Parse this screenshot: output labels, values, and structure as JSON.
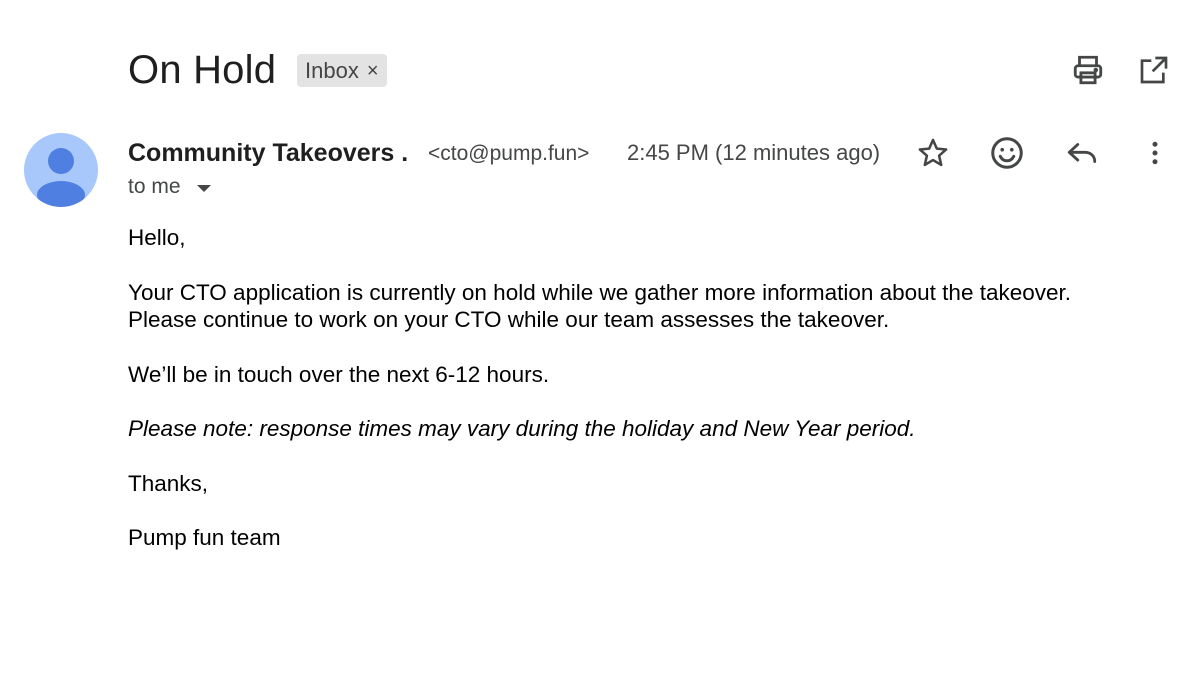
{
  "subject": "On Hold",
  "label_chip": {
    "label": "Inbox",
    "close_glyph": "×"
  },
  "toolbar": {
    "print_icon": "print-icon",
    "popout_icon": "open-in-new-window-icon"
  },
  "sender": {
    "name": "Community Takeovers .",
    "email": "<cto@pump.fun>",
    "timestamp": "2:45 PM (12 minutes ago)",
    "recipient": "to me",
    "avatar_color": "#a8c7fa",
    "avatar_figure_color": "#4f7fe0"
  },
  "actions": {
    "star_icon": "star-icon",
    "emoji_icon": "emoji-react-icon",
    "reply_icon": "reply-icon",
    "more_icon": "more-vert-icon"
  },
  "body": {
    "greeting": "Hello,",
    "line1": "Your CTO application is currently on hold while we gather more information about the takeover.",
    "line2": "Please continue to work on your CTO while our team assesses the takeover.",
    "line3": "We’ll be in touch over the next 6-12 hours.",
    "note": "Please note: response times may vary during the holiday and New Year period.",
    "thanks": "Thanks,",
    "signature": "Pump fun team"
  }
}
